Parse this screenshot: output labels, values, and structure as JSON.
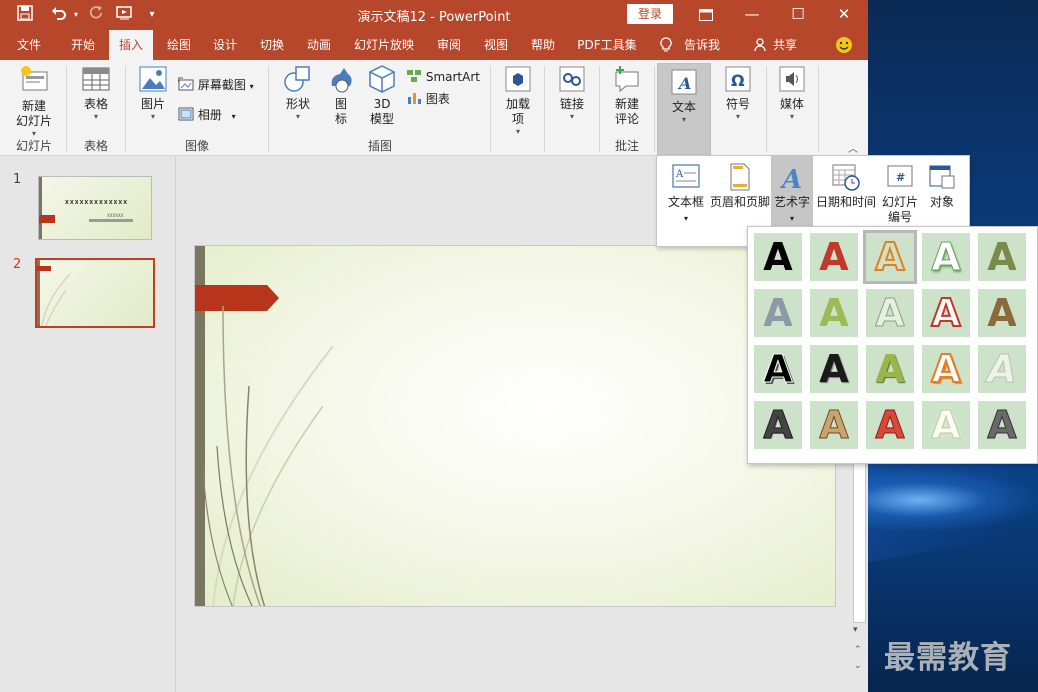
{
  "window": {
    "title": "演示文稿12 - PowerPoint",
    "login_label": "登录"
  },
  "tabs": [
    {
      "label": "文件"
    },
    {
      "label": "开始"
    },
    {
      "label": "插入"
    },
    {
      "label": "绘图"
    },
    {
      "label": "设计"
    },
    {
      "label": "切换"
    },
    {
      "label": "动画"
    },
    {
      "label": "幻灯片放映"
    },
    {
      "label": "审阅"
    },
    {
      "label": "视图"
    },
    {
      "label": "帮助"
    },
    {
      "label": "PDF工具集"
    },
    {
      "label": "告诉我"
    },
    {
      "label": "共享"
    }
  ],
  "active_tab": "插入",
  "ribbon": {
    "new_slide": "新建\n幻灯片",
    "table": "表格",
    "picture": "图片",
    "screenshot": "屏幕截图",
    "album": "相册",
    "shapes": "形状",
    "icons": "图\n标",
    "model3d": "3D\n模型",
    "smartart": "SmartArt",
    "chart": "图表",
    "addins": "加载\n项",
    "link": "链接",
    "new_comment": "新建\n评论",
    "text": "文本",
    "symbol": "符号",
    "media": "媒体",
    "groups": {
      "slides": "幻灯片",
      "tables": "表格",
      "images": "图像",
      "illustrations": "插图",
      "comments": "批注"
    }
  },
  "text_dropdown": {
    "textbox": "文本框",
    "header_footer": "页眉和页脚",
    "wordart": "艺术字",
    "datetime": "日期和时间",
    "slide_number": "幻灯片\n编号",
    "object": "对象"
  },
  "wordart_glyph": "A",
  "wordart_styles": [
    [
      "solid-black",
      "solid-red",
      "orange-outline-selected",
      "white-green-shadow",
      "green-gradient"
    ],
    [
      "gray-reflection",
      "green-reflection",
      "white-outline",
      "red-outline",
      "brown-gradient"
    ],
    [
      "black-white-outline",
      "black-bevel",
      "olive-bevel",
      "orange-bevel",
      "faded-gray"
    ],
    [
      "striped-black",
      "striped-brown",
      "striped-red",
      "white-glow",
      "striped-dark"
    ]
  ],
  "slides": [
    {
      "number": "1",
      "title": "XXXXXXXXXXXXX",
      "subtitle": "XXXXXX"
    },
    {
      "number": "2"
    }
  ],
  "watermark": "最需教育",
  "colors": {
    "accent": "#b7472a",
    "wordart_bg": "#cde3c9"
  }
}
